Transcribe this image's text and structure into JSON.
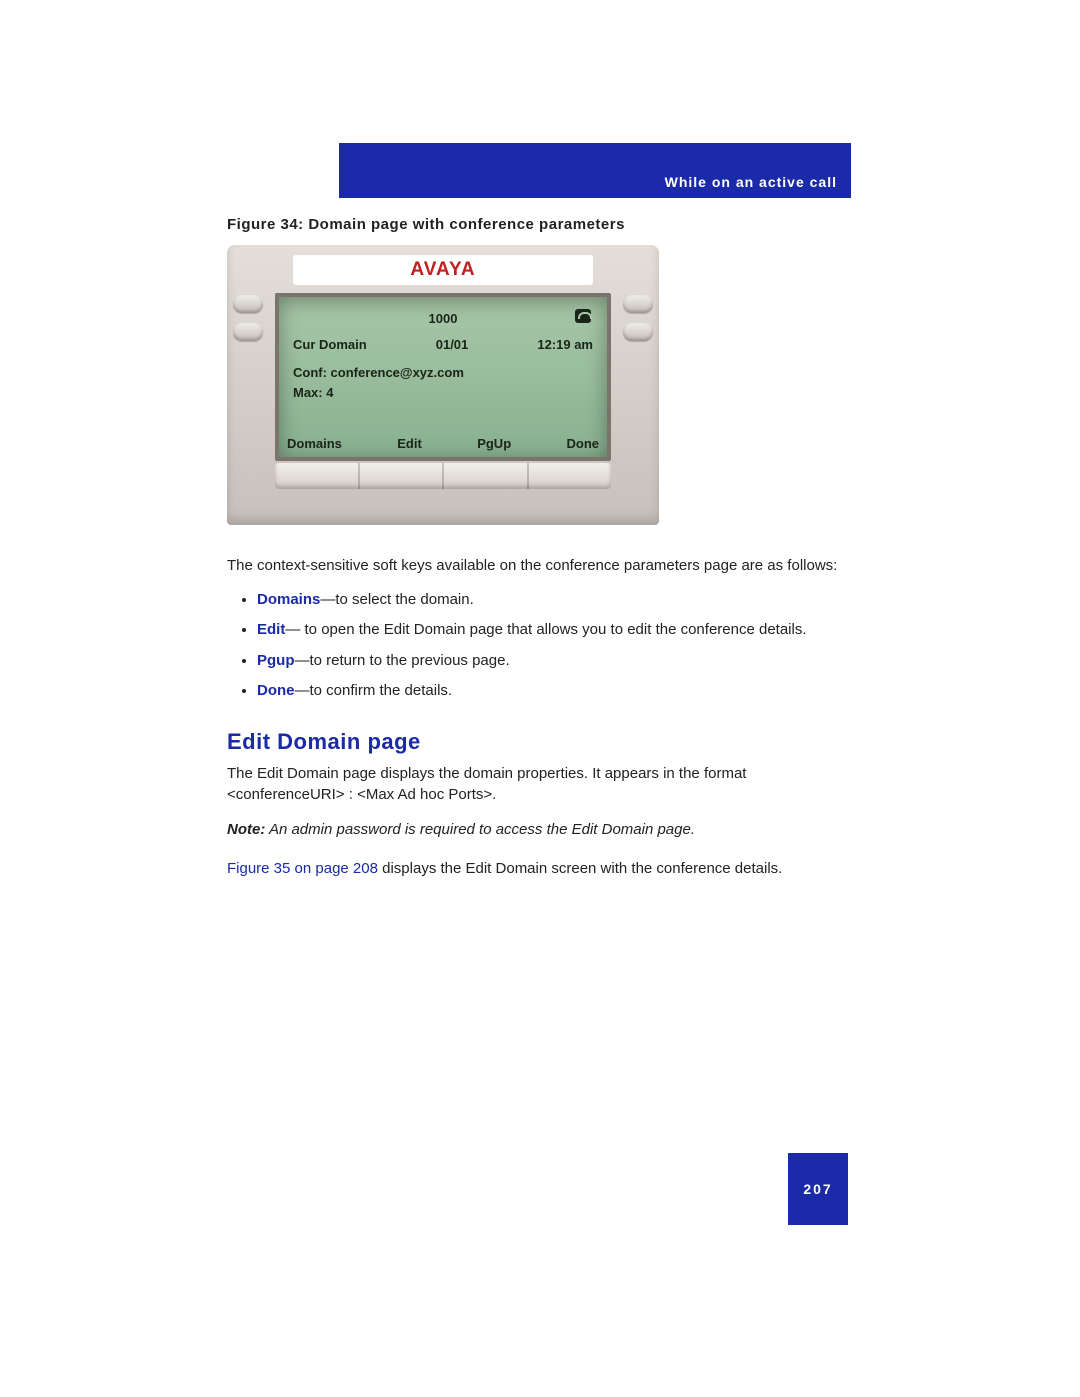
{
  "header": {
    "section_title": "While on an active call"
  },
  "figure": {
    "caption": "Figure 34: Domain page with conference parameters",
    "device": {
      "brand": "AVAYA",
      "screen": {
        "line1_number": "1000",
        "cur_domain_label": "Cur Domain",
        "page_indicator": "01/01",
        "time": "12:19 am",
        "conf_line": "Conf: conference@xyz.com",
        "max_line": "Max: 4",
        "softkeys": [
          "Domains",
          "Edit",
          "PgUp",
          "Done"
        ]
      }
    }
  },
  "body": {
    "intro": "The context-sensitive soft keys available on the conference parameters page are as follows:",
    "items": [
      {
        "term": "Domains",
        "desc": "—to select the domain."
      },
      {
        "term": "Edit",
        "desc": "— to open the Edit Domain page that allows you to edit the conference details."
      },
      {
        "term": "Pgup",
        "desc": "—to return to the previous page."
      },
      {
        "term": "Done",
        "desc": "—to confirm the details."
      }
    ]
  },
  "section": {
    "heading": "Edit Domain page",
    "para1": "The Edit Domain page displays the domain properties. It appears in the format <conferenceURI> : <Max Ad hoc Ports>.",
    "note_label": "Note:",
    "note_text": " An admin password is required to access the Edit Domain page.",
    "xref": "Figure 35 on page 208",
    "xref_tail": " displays the Edit Domain screen with the conference details."
  },
  "page_number": "207"
}
